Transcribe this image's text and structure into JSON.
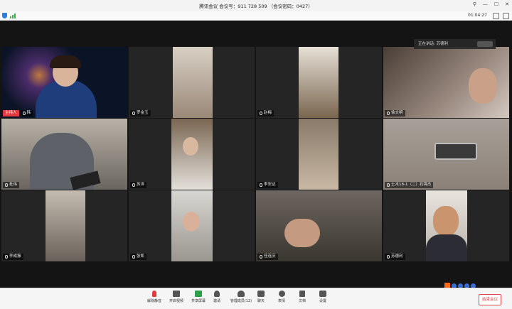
{
  "window": {
    "title": "腾讯会议 会议号：911 728 509 （会议密码：0427）",
    "timer": "01:04:27"
  },
  "speaking": {
    "label": "正在讲话: 苏德利"
  },
  "participants": [
    {
      "name": "韩",
      "host_tag": "主持人",
      "bg": "#0b1426"
    },
    {
      "name": "罗金玉",
      "bg": "#2a2a2a"
    },
    {
      "name": "赵梅",
      "bg": "#2e2a24"
    },
    {
      "name": "徐文明",
      "bg": "#3b3430"
    },
    {
      "name": "杜伟",
      "bg": "#8f8a82"
    },
    {
      "name": "苏洋",
      "bg": "#303030"
    },
    {
      "name": "李安达",
      "bg": "#5a4e42"
    },
    {
      "name": "土木18-1（二）石锦杰",
      "bg": "#6c6660"
    },
    {
      "name": "李成振",
      "bg": "#2a2a2a"
    },
    {
      "name": "张凯",
      "bg": "#303030"
    },
    {
      "name": "任连庆",
      "bg": "#4a4540"
    },
    {
      "name": "苏德利",
      "bg": "#2a2a2a"
    }
  ],
  "toolbar": {
    "mute": "解除静音",
    "video": "开启视频",
    "share": "共享屏幕",
    "invite": "邀请",
    "members": "管理成员(12)",
    "chat": "聊天",
    "reactions": "表情",
    "docs": "文档",
    "settings": "设置",
    "end": "结束会议"
  },
  "colors": {
    "accent": "#2f7de1",
    "danger": "#e23a3a",
    "tile_bg": "#252525"
  }
}
